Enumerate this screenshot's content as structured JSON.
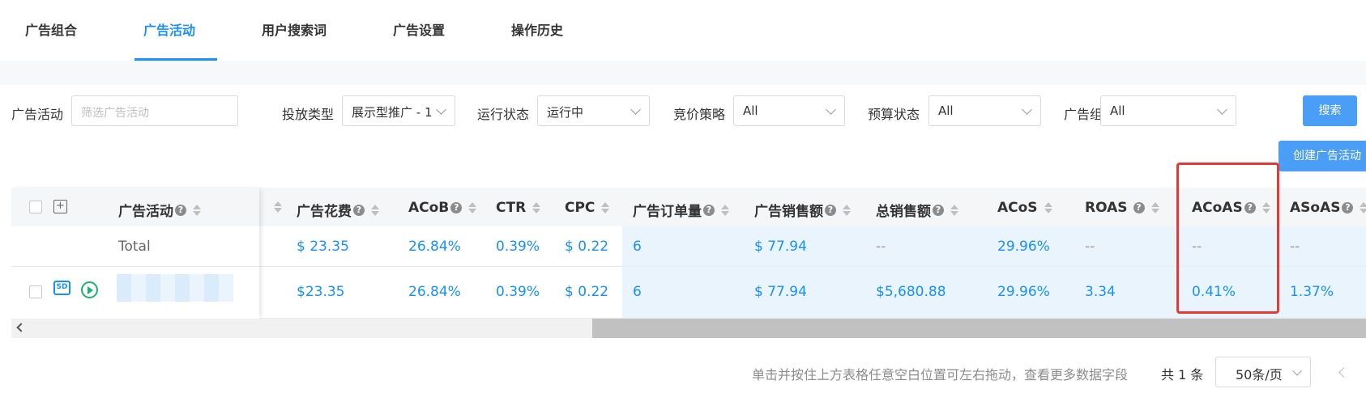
{
  "tabs": [
    {
      "label": "广告组合"
    },
    {
      "label": "广告活动"
    },
    {
      "label": "用户搜索词"
    },
    {
      "label": "广告设置"
    },
    {
      "label": "操作历史"
    }
  ],
  "active_tab": "广告活动",
  "filters": {
    "campaign": {
      "label": "广告活动",
      "placeholder": "筛选广告活动"
    },
    "delivery_type": {
      "label": "投放类型",
      "value": "展示型推广 - 1"
    },
    "run_status": {
      "label": "运行状态",
      "value": "运行中"
    },
    "bid_strategy": {
      "label": "竞价策略",
      "value": "All"
    },
    "budget_status": {
      "label": "预算状态",
      "value": "All"
    },
    "portfolio": {
      "label": "广告组合",
      "value": "All"
    }
  },
  "buttons": {
    "search": "搜索",
    "create_campaign": "创建广告活动"
  },
  "table": {
    "columns": [
      "广告活动",
      "广告花费",
      "ACoB",
      "CTR",
      "CPC",
      "广告订单量",
      "广告销售额",
      "总销售额",
      "ACoS",
      "ROAS",
      "ACoAS",
      "ASoAS"
    ],
    "total_label": "Total",
    "total_row": {
      "spend": "$ 23.35",
      "acob": "26.84%",
      "ctr": "0.39%",
      "cpc": "$ 0.22",
      "orders": "6",
      "ad_sales": "$ 77.94",
      "total_sales": "--",
      "acos": "29.96%",
      "roas": "--",
      "acoas": "--",
      "asoas": "--"
    },
    "rows": [
      {
        "ad_type_badge": "SD",
        "spend": "$23.35",
        "acob": "26.84%",
        "ctr": "0.39%",
        "cpc": "$ 0.22",
        "orders": "6",
        "ad_sales": "$ 77.94",
        "total_sales": "$5,680.88",
        "acos": "29.96%",
        "roas": "3.34",
        "acoas": "0.41%",
        "asoas": "1.37%"
      }
    ]
  },
  "footer": {
    "hint": "单击并按住上方表格任意空白位置可左右拖动，查看更多数据字段",
    "count": "共 1 条",
    "page_size": "50条/页"
  },
  "colors": {
    "accent": "#1890ff",
    "highlight_box": "#e53935",
    "row_highlight": "#eaf4fd"
  }
}
